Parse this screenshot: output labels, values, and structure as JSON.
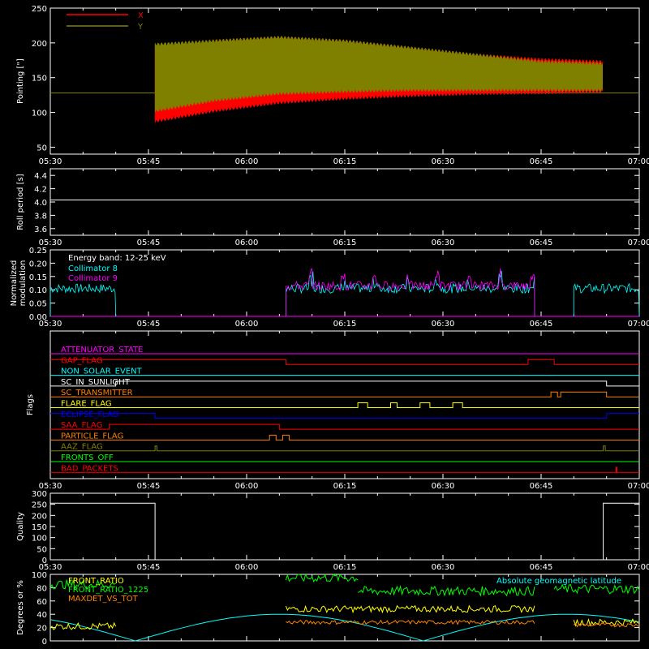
{
  "time_ticks": [
    "05:30",
    "05:45",
    "06:00",
    "06:15",
    "06:30",
    "06:45",
    "07:00"
  ],
  "chart_data": [
    {
      "type": "line",
      "id": "pointing",
      "ylabel": "Pointing [\"]",
      "ylim": [
        40,
        250
      ],
      "yticks": [
        50,
        100,
        150,
        200,
        250
      ],
      "x_unit": "minutes since 05:30",
      "xlim": [
        0,
        90
      ],
      "legend": [
        {
          "name": "X",
          "color": "#ff0000"
        },
        {
          "name": "Y",
          "color": "#808000"
        }
      ],
      "series": [
        {
          "name": "X",
          "color": "#ff0000",
          "envelope": {
            "x": [
              0,
              8,
              15.5,
              16,
              25,
              35,
              45,
              55,
              65,
              75,
              84.5,
              85,
              90
            ],
            "upper": [
              null,
              null,
              null,
              195,
              205,
              210,
              205,
              195,
              185,
              178,
              175,
              null,
              null
            ],
            "lower": [
              null,
              null,
              null,
              85,
              100,
              112,
              118,
              122,
              125,
              126,
              128,
              null,
              null
            ]
          }
        },
        {
          "name": "Y",
          "color": "#808000",
          "envelope": {
            "x": [
              16,
              25,
              35,
              45,
              55,
              65,
              75,
              84.5
            ],
            "upper": [
              200,
              205,
              210,
              205,
              195,
              185,
              175,
              172
            ],
            "lower": [
              100,
              115,
              125,
              128,
              130,
              130,
              130,
              130
            ]
          }
        }
      ],
      "baseline": 128
    },
    {
      "type": "line",
      "id": "roll-period",
      "ylabel": "Roll period [s]",
      "ylim": [
        3.5,
        4.5
      ],
      "yticks": [
        "3.6",
        "3.8",
        "4.0",
        "4.2",
        "4.4"
      ],
      "xlim": [
        0,
        90
      ],
      "series": [
        {
          "name": "",
          "color": "#ffffff",
          "x": [
            0,
            90
          ],
          "y": [
            4.03,
            4.03
          ]
        }
      ]
    },
    {
      "type": "line",
      "id": "modulation",
      "ylabel": "Normalized modulation",
      "ylim": [
        0,
        0.25
      ],
      "yticks": [
        "0.00",
        "0.05",
        "0.10",
        "0.15",
        "0.20",
        "0.25"
      ],
      "xlim": [
        0,
        90
      ],
      "annotation": "Energy band: 12-25 keV",
      "series": [
        {
          "name": "Collimator 8",
          "color": "#00ffff",
          "segments": [
            [
              0,
              10
            ],
            [
              36,
              74
            ],
            [
              80,
              90
            ]
          ],
          "level": 0.105
        },
        {
          "name": "Collimator 9",
          "color": "#ff00ff",
          "segments": [
            [
              36,
              74
            ]
          ],
          "level": 0.115
        }
      ]
    },
    {
      "type": "line",
      "id": "flags",
      "ylabel": "Flags",
      "xlim": [
        0,
        90
      ],
      "series": [
        {
          "name": "ATTENUATOR_STATE",
          "color": "#ff00ff",
          "steps": []
        },
        {
          "name": "GAP_FLAG",
          "color": "#ff0000",
          "steps": [
            [
              0,
              36,
              1
            ],
            [
              36,
              73,
              0
            ],
            [
              73,
              77,
              1
            ],
            [
              77,
              90,
              0
            ]
          ]
        },
        {
          "name": "NON_SOLAR_EVENT",
          "color": "#00ffff",
          "steps": []
        },
        {
          "name": "SC_IN_SUNLIGHT",
          "color": "#ffffff",
          "steps": [
            [
              0,
              10,
              0
            ],
            [
              10,
              85,
              1
            ],
            [
              85,
              90,
              0
            ]
          ]
        },
        {
          "name": "SC_TRANSMITTER",
          "color": "#ff8000",
          "steps": [
            [
              0,
              76.5,
              0
            ],
            [
              76.5,
              77.5,
              1
            ],
            [
              77.5,
              78,
              0
            ],
            [
              78,
              85,
              1
            ],
            [
              85,
              90,
              0
            ]
          ]
        },
        {
          "name": "FLARE_FLAG",
          "color": "#ffff00",
          "steps": [
            [
              0,
              47,
              0
            ],
            [
              47,
              48.5,
              1
            ],
            [
              48.5,
              52,
              0
            ],
            [
              52,
              53,
              1
            ],
            [
              53,
              56.5,
              0
            ],
            [
              56.5,
              58,
              1
            ],
            [
              58,
              61.5,
              0
            ],
            [
              61.5,
              63,
              1
            ],
            [
              63,
              90,
              0
            ]
          ]
        },
        {
          "name": "ECLIPSE_FLAG",
          "color": "#0000ff",
          "steps": [
            [
              0,
              16,
              1
            ],
            [
              16,
              85,
              0
            ],
            [
              85,
              90,
              1
            ]
          ]
        },
        {
          "name": "SAA_FLAG",
          "color": "#ff0000",
          "steps": [
            [
              0,
              9,
              0
            ],
            [
              9,
              35,
              1
            ],
            [
              35,
              90,
              0
            ]
          ]
        },
        {
          "name": "PARTICLE_FLAG",
          "color": "#ff8000",
          "steps": [
            [
              0,
              33.5,
              0
            ],
            [
              33.5,
              34.5,
              1
            ],
            [
              34.5,
              35.5,
              0
            ],
            [
              35.5,
              36.5,
              1
            ],
            [
              36.5,
              90,
              0
            ]
          ]
        },
        {
          "name": "AAZ_FLAG",
          "color": "#808000",
          "steps": [
            [
              0,
              16,
              0
            ],
            [
              16,
              16.3,
              1
            ],
            [
              16.3,
              84.5,
              0
            ],
            [
              84.5,
              84.8,
              1
            ],
            [
              84.8,
              90,
              0
            ]
          ]
        },
        {
          "name": "FRONTS_OFF",
          "color": "#00ff00",
          "steps": []
        },
        {
          "name": "BAD_PACKETS",
          "color": "#ff0000",
          "steps": [],
          "spikes": [
            86.5
          ]
        }
      ]
    },
    {
      "type": "line",
      "id": "quality",
      "ylabel": "Quality",
      "ylim": [
        0,
        300
      ],
      "yticks": [
        0,
        50,
        100,
        150,
        200,
        250,
        300
      ],
      "xlim": [
        0,
        90
      ],
      "series": [
        {
          "name": "",
          "color": "#ffffff",
          "x": [
            0,
            16,
            16,
            84.5,
            84.5,
            90
          ],
          "y": [
            255,
            255,
            0,
            0,
            255,
            255
          ]
        }
      ]
    },
    {
      "type": "line",
      "id": "geometry",
      "ylabel": "Degrees or %",
      "ylim": [
        0,
        100
      ],
      "yticks": [
        0,
        20,
        40,
        60,
        80,
        100
      ],
      "xlim": [
        0,
        90
      ],
      "legend_right": "Absolute geomagnetic latitude",
      "series": [
        {
          "name": "FRONT_RATIO",
          "color": "#ffff00"
        },
        {
          "name": "FRONT_RATIO_1225",
          "color": "#00ff00"
        },
        {
          "name": "MAXDET_VS_TOT",
          "color": "#ff8000"
        },
        {
          "name": "Absolute geomagnetic latitude",
          "color": "#00ffff"
        }
      ]
    }
  ]
}
